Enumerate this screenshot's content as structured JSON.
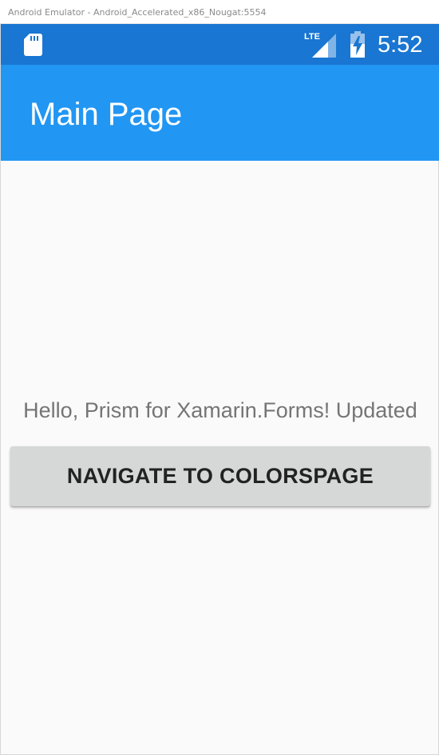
{
  "window": {
    "title": "Android Emulator - Android_Accelerated_x86_Nougat:5554"
  },
  "status_bar": {
    "background": "#1976d2",
    "left_icon": "sd-card-icon",
    "network_label": "LTE",
    "network_icon": "lte-signal-icon",
    "battery_icon": "battery-charging-icon",
    "time": "5:52"
  },
  "app_bar": {
    "background": "#2196f3",
    "title": "Main Page"
  },
  "main": {
    "label": "Hello, Prism for Xamarin.Forms! Updated",
    "button_label": "NAVIGATE TO COLORSPAGE"
  }
}
